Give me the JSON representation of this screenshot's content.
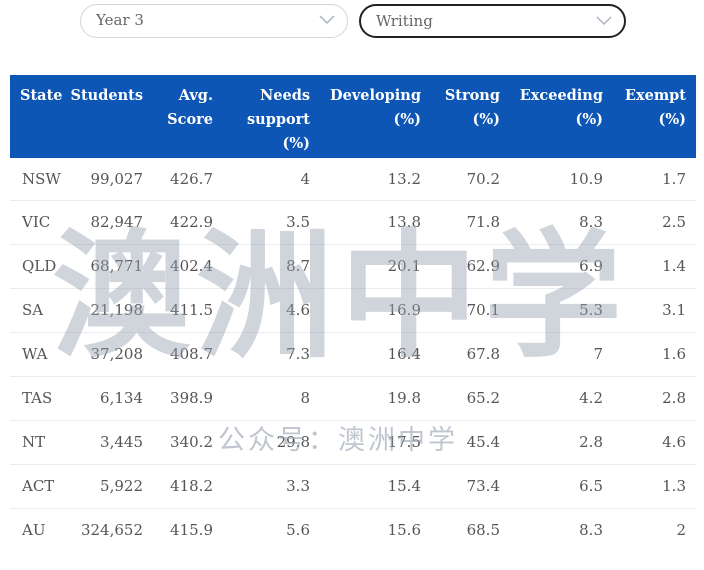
{
  "filters": {
    "year": "Year 3",
    "subject": "Writing"
  },
  "table": {
    "headers": [
      "State",
      "Students",
      "Avg.\nScore",
      "Needs\nsupport\n(%)",
      "Developing\n(%)",
      "Strong\n(%)",
      "Exceeding\n(%)",
      "Exempt\n(%)"
    ],
    "rows": [
      [
        "NSW",
        "99,027",
        "426.7",
        "4",
        "13.2",
        "70.2",
        "10.9",
        "1.7"
      ],
      [
        "VIC",
        "82,947",
        "422.9",
        "3.5",
        "13.8",
        "71.8",
        "8.3",
        "2.5"
      ],
      [
        "QLD",
        "68,771",
        "402.4",
        "8.7",
        "20.1",
        "62.9",
        "6.9",
        "1.4"
      ],
      [
        "SA",
        "21,198",
        "411.5",
        "4.6",
        "16.9",
        "70.1",
        "5.3",
        "3.1"
      ],
      [
        "WA",
        "37,208",
        "408.7",
        "7.3",
        "16.4",
        "67.8",
        "7",
        "1.6"
      ],
      [
        "TAS",
        "6,134",
        "398.9",
        "8",
        "19.8",
        "65.2",
        "4.2",
        "2.8"
      ],
      [
        "NT",
        "3,445",
        "340.2",
        "29.8",
        "17.5",
        "45.4",
        "2.8",
        "4.6"
      ],
      [
        "ACT",
        "5,922",
        "418.2",
        "3.3",
        "15.4",
        "73.4",
        "6.5",
        "1.3"
      ],
      [
        "AU",
        "324,652",
        "415.9",
        "5.6",
        "15.6",
        "68.5",
        "8.3",
        "2"
      ]
    ]
  },
  "watermark": {
    "main": "澳洲中学",
    "sub": "公众号：澳洲中学"
  },
  "colors": {
    "header_bg": "#0d56b6",
    "header_text": "#ffffff",
    "cell_text": "#555555"
  }
}
